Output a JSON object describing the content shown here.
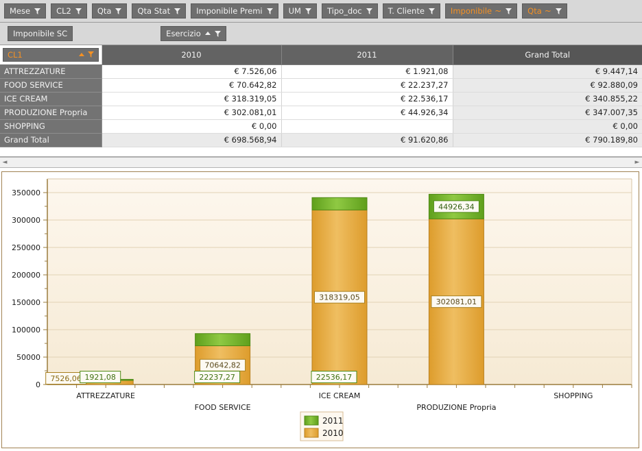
{
  "toolbar_top": {
    "buttons": [
      {
        "label": "Mese",
        "accent": false,
        "filter": true,
        "sum": false
      },
      {
        "label": "CL2",
        "accent": false,
        "filter": true,
        "sum": false
      },
      {
        "label": "Qta",
        "accent": false,
        "filter": true,
        "sum": false
      },
      {
        "label": "Qta Stat",
        "accent": false,
        "filter": true,
        "sum": false
      },
      {
        "label": "Imponibile Premi",
        "accent": false,
        "filter": true,
        "sum": false
      },
      {
        "label": "UM",
        "accent": false,
        "filter": true,
        "sum": false
      },
      {
        "label": "Tipo_doc",
        "accent": false,
        "filter": true,
        "sum": false
      },
      {
        "label": "T. Cliente",
        "accent": false,
        "filter": true,
        "sum": false
      },
      {
        "label": "Imponibile",
        "accent": true,
        "filter": true,
        "sum": true,
        "sum_glyph": "~"
      },
      {
        "label": "Qta",
        "accent": true,
        "filter": true,
        "sum": true,
        "sum_glyph": "~"
      }
    ]
  },
  "toolbar_second": {
    "value_button": {
      "label": "Imponibile SC"
    },
    "column_button": {
      "label": "Esercizio",
      "sort": "asc",
      "filter": true
    }
  },
  "pivot": {
    "corner": {
      "label": "CL1",
      "sort": "asc",
      "filter": true
    },
    "columns": [
      "2010",
      "2011",
      "Grand Total"
    ],
    "rows": [
      {
        "label": "ATTREZZATURE",
        "values": [
          "€ 7.526,06",
          "€ 1.921,08",
          "€ 9.447,14"
        ]
      },
      {
        "label": "FOOD SERVICE",
        "values": [
          "€ 70.642,82",
          "€ 22.237,27",
          "€ 92.880,09"
        ]
      },
      {
        "label": "ICE CREAM",
        "values": [
          "€ 318.319,05",
          "€ 22.536,17",
          "€ 340.855,22"
        ]
      },
      {
        "label": "PRODUZIONE Propria",
        "values": [
          "€ 302.081,01",
          "€ 44.926,34",
          "€ 347.007,35"
        ]
      },
      {
        "label": "SHOPPING",
        "values": [
          "€ 0,00",
          "",
          "€ 0,00"
        ]
      }
    ],
    "total_row": {
      "label": "Grand Total",
      "values": [
        "€ 698.568,94",
        "€ 91.620,86",
        "€ 790.189,80"
      ]
    },
    "scrollbar": {
      "left_arrow": "◄",
      "right_arrow": "►"
    }
  },
  "chart_data": {
    "type": "bar",
    "stacked": true,
    "title": "",
    "xlabel": "",
    "ylabel": "",
    "categories": [
      "ATTREZZATURE",
      "FOOD SERVICE",
      "ICE CREAM",
      "PRODUZIONE Propria",
      "SHOPPING"
    ],
    "series": [
      {
        "name": "2010",
        "color": "#e3a83c",
        "values": [
          7526.06,
          70642.82,
          318319.05,
          302081.01,
          0
        ],
        "labels": [
          "7526,06",
          "70642,82",
          "318319,05",
          "302081,01",
          ""
        ]
      },
      {
        "name": "2011",
        "color": "#72b02b",
        "values": [
          1921.08,
          22237.27,
          22536.17,
          44926.34,
          0
        ],
        "labels": [
          "1921,08",
          "22237,27",
          "22536,17",
          "44926,34",
          ""
        ]
      }
    ],
    "ylim": [
      0,
      375000
    ],
    "yticks": [
      0,
      50000,
      100000,
      150000,
      200000,
      250000,
      300000,
      350000
    ],
    "ytick_labels": [
      "0",
      "50000",
      "100000",
      "150000",
      "200000",
      "250000",
      "300000",
      "350000"
    ],
    "grid": true,
    "legend_position": "bottom-center",
    "legend": [
      "2011",
      "2010"
    ],
    "plot_bg": "#faf1e1",
    "axis_color": "#9a7b3c"
  },
  "colors": {
    "accent": "#f59123",
    "series_2010": "#e3a83c",
    "series_2011": "#72b02b",
    "toolbar_bg": "#d8d8d8",
    "button_bg": "#6e6e6e",
    "header_bg": "#636363"
  }
}
